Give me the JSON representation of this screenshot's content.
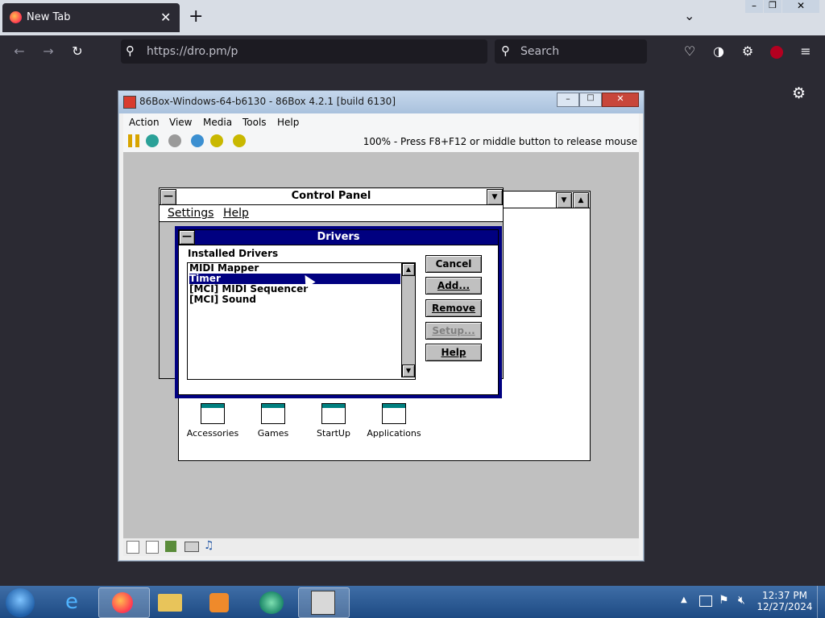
{
  "browser": {
    "tab_title": "New Tab",
    "url": "https://dro.pm/p",
    "search_placeholder": "Search"
  },
  "emulator": {
    "title": "86Box-Windows-64-b6130 - 86Box 4.2.1 [build 6130]",
    "menu": [
      "Action",
      "View",
      "Media",
      "Tools",
      "Help"
    ],
    "status_text": "100% - Press F8+F12 or middle button to release mouse"
  },
  "control_panel": {
    "title": "Control Panel",
    "menu": [
      "Settings",
      "Help"
    ]
  },
  "drivers": {
    "title": "Drivers",
    "label": "Installed Drivers",
    "items": [
      "MIDI Mapper",
      "Timer",
      "[MCI] MIDI Sequencer",
      "[MCI] Sound"
    ],
    "selected_index": 1,
    "buttons": {
      "cancel": "Cancel",
      "add": "Add...",
      "remove": "Remove",
      "setup": "Setup...",
      "help": "Help"
    }
  },
  "program_groups": [
    "Accessories",
    "Games",
    "StartUp",
    "Applications"
  ],
  "taskbar": {
    "time": "12:37 PM",
    "date": "12/27/2024"
  }
}
